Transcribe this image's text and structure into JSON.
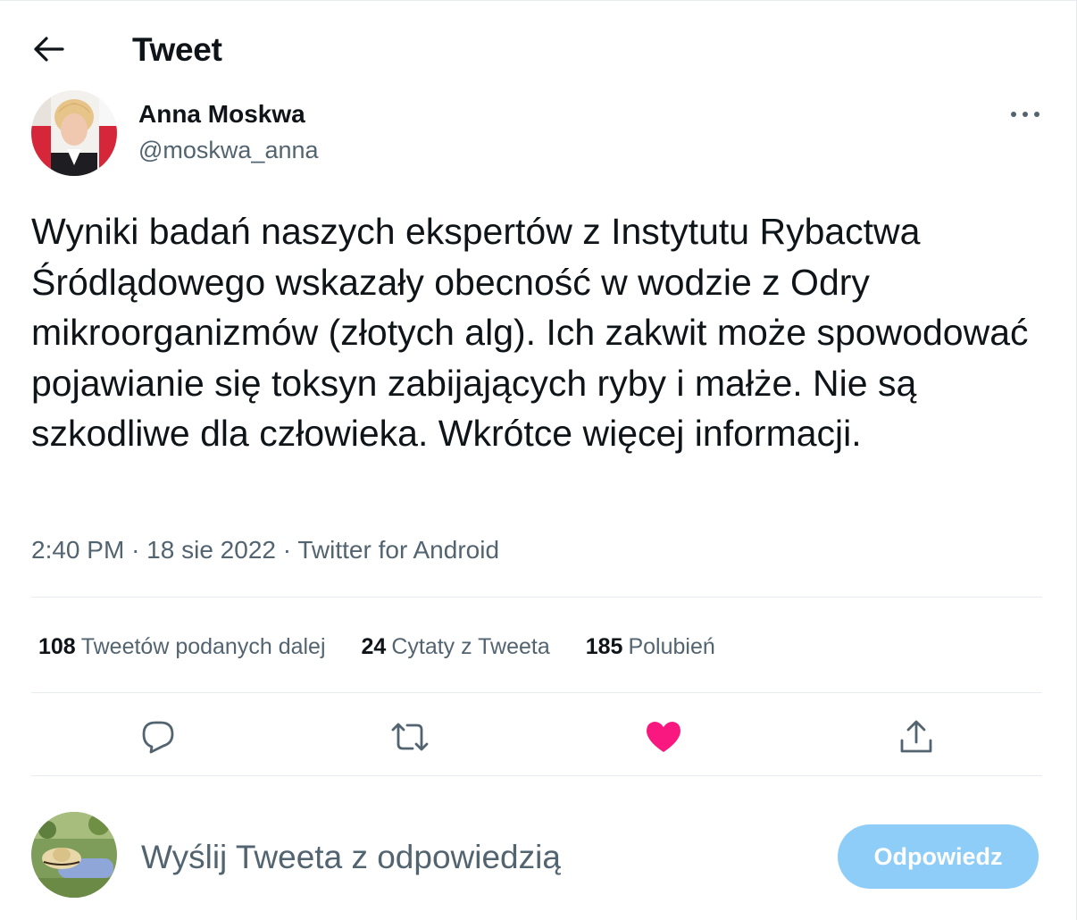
{
  "header": {
    "title": "Tweet",
    "back_icon": "arrow-left-icon"
  },
  "author": {
    "name": "Anna Moskwa",
    "handle": "@moskwa_anna"
  },
  "tweet": {
    "text": "Wyniki badań naszych ekspertów z Instytutu Rybactwa Śródlądowego wskazały obecność w wodzie z Odry mikroorganizmów (złotych alg). Ich zakwit może spowodować pojawianie się toksyn zabijających ryby i małże. Nie są szkodliwe dla człowieka. Wkrótce więcej informacji.",
    "time": "2:40 PM",
    "date": "18 sie 2022",
    "source": "Twitter for Android",
    "separator": "·"
  },
  "stats": {
    "retweets": {
      "count": "108",
      "label": "Tweetów podanych dalej"
    },
    "quotes": {
      "count": "24",
      "label": "Cytaty z Tweeta"
    },
    "likes": {
      "count": "185",
      "label": "Polubień"
    }
  },
  "actions": {
    "reply_icon": "speech-bubble-icon",
    "retweet_icon": "retweet-icon",
    "like_icon": "heart-icon",
    "share_icon": "share-icon",
    "like_color": "#f91880",
    "icon_color": "#536471"
  },
  "reply": {
    "placeholder": "Wyślij Tweeta z odpowiedzią",
    "button_label": "Odpowiedz",
    "button_color": "#8ecdf8"
  }
}
